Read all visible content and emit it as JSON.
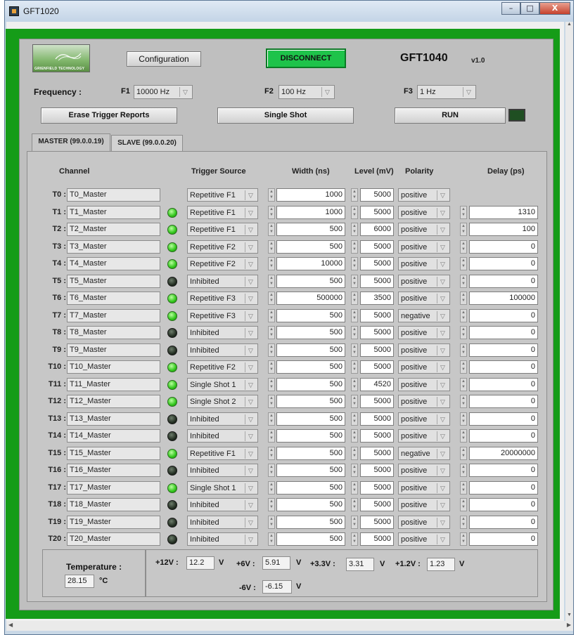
{
  "window": {
    "title": "GFT1020",
    "minimize": "–",
    "maximize": "□",
    "close": "X"
  },
  "logo": {
    "text": "GRIENFIELD TECHNOLOGY"
  },
  "header": {
    "configuration_label": "Configuration",
    "disconnect_label": "DISCONNECT",
    "model": "GFT1040",
    "version": "v1.0"
  },
  "frequency": {
    "label": "Frequency :",
    "f1_label": "F1",
    "f1_value": "10000 Hz",
    "f2_label": "F2",
    "f2_value": "100 Hz",
    "f3_label": "F3",
    "f3_value": "1 Hz"
  },
  "actions": {
    "erase_label": "Erase Trigger Reports",
    "single_shot_label": "Single Shot",
    "run_label": "RUN"
  },
  "tabs": [
    {
      "label": "MASTER (99.0.0.19)"
    },
    {
      "label": "SLAVE (99.0.0.20)"
    }
  ],
  "columns": {
    "channel": "Channel",
    "trigger_source": "Trigger Source",
    "width": "Width (ns)",
    "level": "Level (mV)",
    "polarity": "Polarity",
    "delay": "Delay (ps)"
  },
  "channels": [
    {
      "label": "T0 :",
      "name": "T0_Master",
      "led": null,
      "trigger": "Repetitive F1",
      "width": "1000",
      "level": "5000",
      "polarity": "positive",
      "delay": null
    },
    {
      "label": "T1 :",
      "name": "T1_Master",
      "led": "on",
      "trigger": "Repetitive F1",
      "width": "1000",
      "level": "5000",
      "polarity": "positive",
      "delay": "1310"
    },
    {
      "label": "T2 :",
      "name": "T2_Master",
      "led": "on",
      "trigger": "Repetitive F1",
      "width": "500",
      "level": "6000",
      "polarity": "positive",
      "delay": "100"
    },
    {
      "label": "T3 :",
      "name": "T3_Master",
      "led": "on",
      "trigger": "Repetitive F2",
      "width": "500",
      "level": "5000",
      "polarity": "positive",
      "delay": "0"
    },
    {
      "label": "T4 :",
      "name": "T4_Master",
      "led": "on",
      "trigger": "Repetitive F2",
      "width": "10000",
      "level": "5000",
      "polarity": "positive",
      "delay": "0"
    },
    {
      "label": "T5 :",
      "name": "T5_Master",
      "led": "off",
      "trigger": "Inhibited",
      "width": "500",
      "level": "5000",
      "polarity": "positive",
      "delay": "0"
    },
    {
      "label": "T6 :",
      "name": "T6_Master",
      "led": "on",
      "trigger": "Repetitive F3",
      "width": "500000",
      "level": "3500",
      "polarity": "positive",
      "delay": "100000"
    },
    {
      "label": "T7 :",
      "name": "T7_Master",
      "led": "on",
      "trigger": "Repetitive F3",
      "width": "500",
      "level": "5000",
      "polarity": "negative",
      "delay": "0"
    },
    {
      "label": "T8 :",
      "name": "T8_Master",
      "led": "off",
      "trigger": "Inhibited",
      "width": "500",
      "level": "5000",
      "polarity": "positive",
      "delay": "0"
    },
    {
      "label": "T9 :",
      "name": "T9_Master",
      "led": "off",
      "trigger": "Inhibited",
      "width": "500",
      "level": "5000",
      "polarity": "positive",
      "delay": "0"
    },
    {
      "label": "T10 :",
      "name": "T10_Master",
      "led": "on",
      "trigger": "Repetitive F2",
      "width": "500",
      "level": "5000",
      "polarity": "positive",
      "delay": "0"
    },
    {
      "label": "T11 :",
      "name": "T11_Master",
      "led": "on",
      "trigger": "Single Shot 1",
      "width": "500",
      "level": "4520",
      "polarity": "positive",
      "delay": "0"
    },
    {
      "label": "T12 :",
      "name": "T12_Master",
      "led": "on",
      "trigger": "Single Shot 2",
      "width": "500",
      "level": "5000",
      "polarity": "positive",
      "delay": "0"
    },
    {
      "label": "T13 :",
      "name": "T13_Master",
      "led": "off",
      "trigger": "Inhibited",
      "width": "500",
      "level": "5000",
      "polarity": "positive",
      "delay": "0"
    },
    {
      "label": "T14 :",
      "name": "T14_Master",
      "led": "off",
      "trigger": "Inhibited",
      "width": "500",
      "level": "5000",
      "polarity": "positive",
      "delay": "0"
    },
    {
      "label": "T15 :",
      "name": "T15_Master",
      "led": "on",
      "trigger": "Repetitive F1",
      "width": "500",
      "level": "5000",
      "polarity": "negative",
      "delay": "20000000"
    },
    {
      "label": "T16 :",
      "name": "T16_Master",
      "led": "off",
      "trigger": "Inhibited",
      "width": "500",
      "level": "5000",
      "polarity": "positive",
      "delay": "0"
    },
    {
      "label": "T17 :",
      "name": "T17_Master",
      "led": "on",
      "trigger": "Single Shot 1",
      "width": "500",
      "level": "5000",
      "polarity": "positive",
      "delay": "0"
    },
    {
      "label": "T18 :",
      "name": "T18_Master",
      "led": "off",
      "trigger": "Inhibited",
      "width": "500",
      "level": "5000",
      "polarity": "positive",
      "delay": "0"
    },
    {
      "label": "T19 :",
      "name": "T19_Master",
      "led": "off",
      "trigger": "Inhibited",
      "width": "500",
      "level": "5000",
      "polarity": "positive",
      "delay": "0"
    },
    {
      "label": "T20 :",
      "name": "T20_Master",
      "led": "off",
      "trigger": "Inhibited",
      "width": "500",
      "level": "5000",
      "polarity": "positive",
      "delay": "0"
    }
  ],
  "temperature": {
    "label": "Temperature :",
    "value": "28.15",
    "unit": "°C"
  },
  "voltages": {
    "p12_label": "+12V :",
    "p12_value": "12.2",
    "p6_label": "+6V :",
    "p6_value": "5.91",
    "p33_label": "+3.3V :",
    "p33_value": "3.31",
    "p12b_label": "+1.2V :",
    "p12b_value": "1.23",
    "n6_label": "-6V :",
    "n6_value": "-6.15",
    "unit": "V"
  },
  "colors": {
    "frame_green": "#159c18",
    "disconnect_green": "#1ec34a",
    "led_on": "#31c51b",
    "led_off": "#1f2a1e"
  }
}
